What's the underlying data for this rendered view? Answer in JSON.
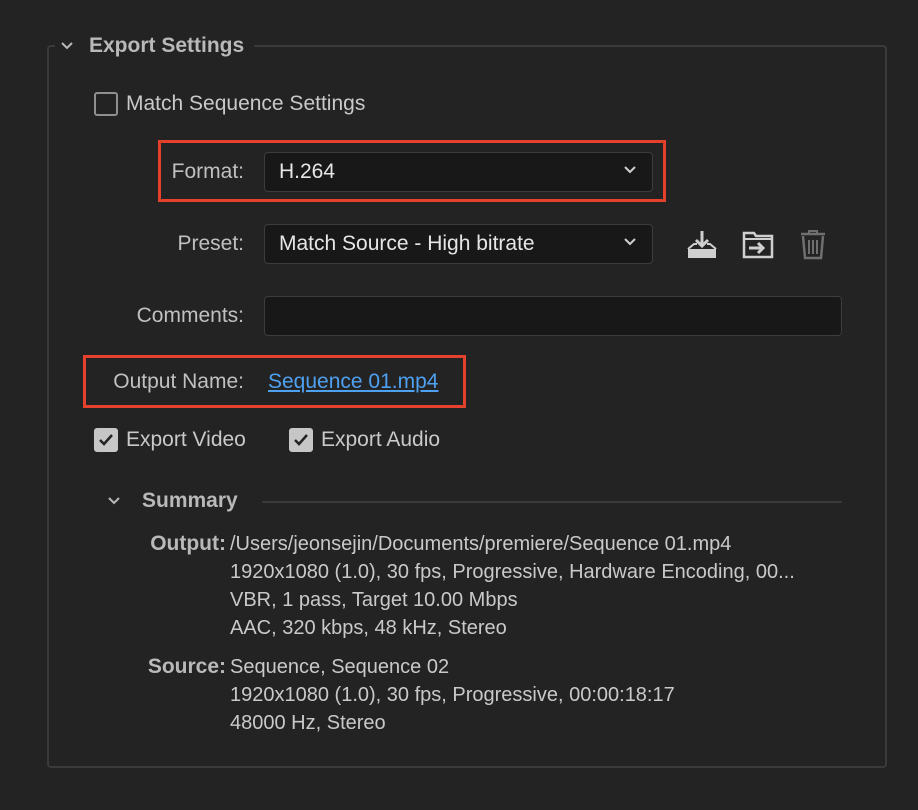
{
  "export_settings": {
    "title": "Export Settings",
    "match_sequence": {
      "label": "Match Sequence Settings",
      "checked": false
    },
    "format": {
      "label": "Format:",
      "value": "H.264"
    },
    "preset": {
      "label": "Preset:",
      "value": "Match Source - High bitrate"
    },
    "comments": {
      "label": "Comments:",
      "value": ""
    },
    "output_name": {
      "label": "Output Name:",
      "value": "Sequence 01.mp4"
    },
    "export_video": {
      "label": "Export Video",
      "checked": true
    },
    "export_audio": {
      "label": "Export Audio",
      "checked": true
    },
    "preset_icons": [
      "save-preset-icon",
      "import-preset-icon",
      "delete-preset-icon"
    ]
  },
  "summary": {
    "title": "Summary",
    "output_label": "Output:",
    "output_lines": [
      "/Users/jeonsejin/Documents/premiere/Sequence 01.mp4",
      "1920x1080 (1.0), 30 fps, Progressive, Hardware Encoding, 00...",
      "VBR, 1 pass, Target 10.00 Mbps",
      "AAC, 320 kbps, 48 kHz, Stereo"
    ],
    "source_label": "Source:",
    "source_lines": [
      "Sequence, Sequence 02",
      "1920x1080 (1.0), 30 fps, Progressive, 00:00:18:17",
      "48000 Hz, Stereo"
    ]
  },
  "colors": {
    "background": "#232323",
    "highlight_box": "#e5412d",
    "link": "#4ea0f0"
  }
}
